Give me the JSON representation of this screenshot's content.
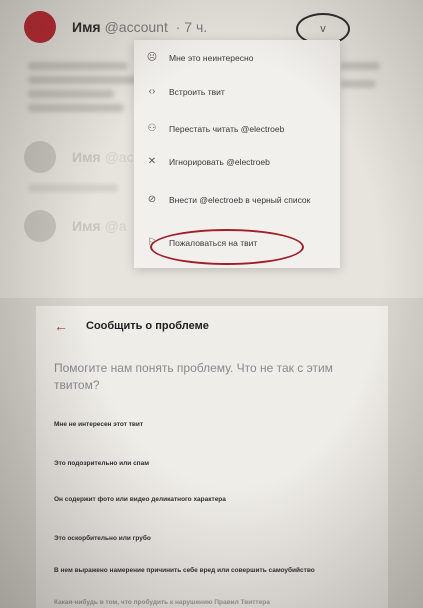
{
  "timeline": {
    "tweet": {
      "name": "Имя",
      "handle": "@account",
      "time": "· 7 ч."
    },
    "faded_tweets": [
      {
        "name": "Имя",
        "handle": "@ac"
      },
      {
        "name": "Имя",
        "handle": "@a"
      }
    ],
    "caret_label": "v"
  },
  "menu": {
    "items": [
      {
        "icon": "sad-face-icon",
        "glyph": "☹",
        "label": "Мне это неинтересно"
      },
      {
        "icon": "embed-code-icon",
        "glyph": "‹›",
        "label": "Встроить твит"
      },
      {
        "icon": "unfollow-person-icon",
        "glyph": "⚇",
        "label": "Перестать читать @electroeb"
      },
      {
        "icon": "mute-icon",
        "glyph": "✕",
        "label": "Игнорировать @electroeb"
      },
      {
        "icon": "block-icon",
        "glyph": "⊘",
        "label": "Внести @electroeb в черный список"
      },
      {
        "icon": "flag-icon",
        "glyph": "⚐",
        "label": "Пожаловаться на твит"
      }
    ]
  },
  "dialog": {
    "title": "Сообщить о проблеме",
    "back_glyph": "←",
    "question": "Помогите нам понять проблему. Что не так с этим твитом?",
    "reasons": [
      "Мне не интересен этот твит",
      "Это подозрительно или спам",
      "Он содержит фото или видео деликатного характера",
      "Это оскорбительно или грубо",
      "В нем выражено намерение причинить себе вред или совершить самоубийство",
      "Какая-нибудь в том, что пробудить к нарушению Правил Твиттера"
    ]
  },
  "colors": {
    "accent_red": "#b8232c",
    "oval_red": "#a01f2b",
    "background": "#e7e4de"
  }
}
